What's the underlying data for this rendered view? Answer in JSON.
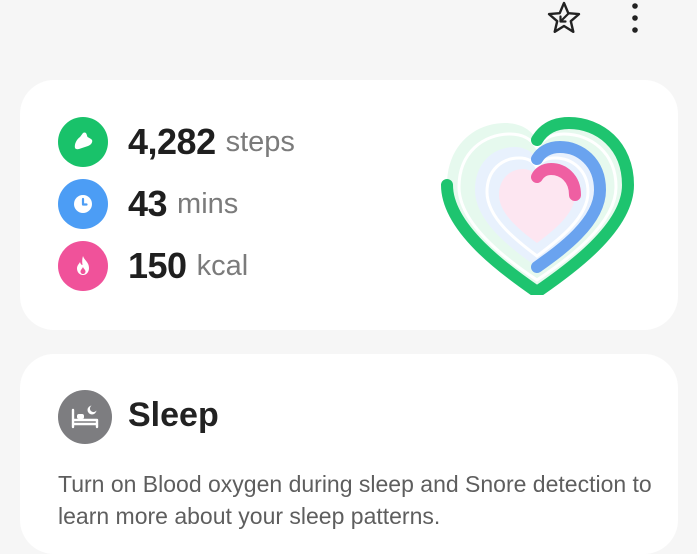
{
  "header": {
    "favorite_icon": "star-arrow-icon",
    "more_icon": "more-vertical-icon"
  },
  "activity": {
    "steps": {
      "value": "4,282",
      "unit": "steps",
      "icon": "shoe-icon",
      "color": "#19c26a"
    },
    "active_time": {
      "value": "43",
      "unit": "mins",
      "icon": "clock-icon",
      "color": "#4c9df5"
    },
    "calories": {
      "value": "150",
      "unit": "kcal",
      "icon": "flame-icon",
      "color": "#f0529a"
    },
    "heart_ring_colors": {
      "outer": "#1ec46f",
      "middle": "#6aa3ef",
      "inner": "#ef5fa2"
    }
  },
  "sleep": {
    "title": "Sleep",
    "icon": "bed-icon",
    "description": "Turn on Blood oxygen during sleep and Snore detection to learn more about your sleep patterns."
  }
}
